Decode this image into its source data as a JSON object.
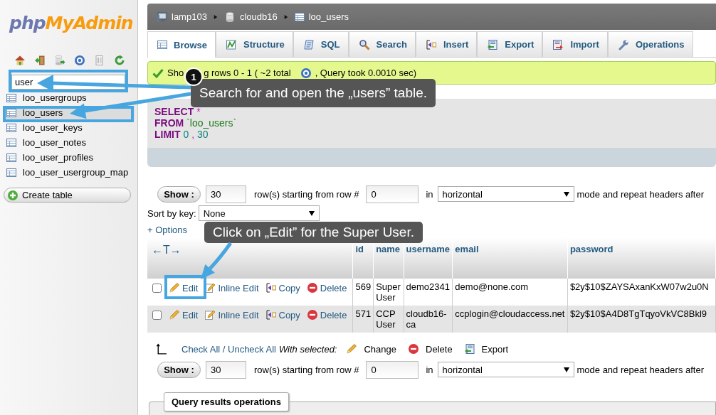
{
  "logo": {
    "part_1": "php",
    "part_2": "MyAdmin"
  },
  "sidebar": {
    "filter": {
      "value": "user"
    },
    "tables": [
      {
        "name": "loo_usergroups",
        "selected": false
      },
      {
        "name": "loo_users",
        "selected": true
      },
      {
        "name": "loo_user_keys",
        "selected": false
      },
      {
        "name": "loo_user_notes",
        "selected": false
      },
      {
        "name": "loo_user_profiles",
        "selected": false
      },
      {
        "name": "loo_user_usergroup_map",
        "selected": false
      }
    ],
    "create_button": "Create table"
  },
  "breadcrumb": [
    "lamp103",
    "cloudb16",
    "loo_users"
  ],
  "tabs": [
    {
      "label": "Browse",
      "selected": true
    },
    {
      "label": "Structure",
      "selected": false
    },
    {
      "label": "SQL",
      "selected": false
    },
    {
      "label": "Search",
      "selected": false
    },
    {
      "label": "Insert",
      "selected": false
    },
    {
      "label": "Export",
      "selected": false
    },
    {
      "label": "Import",
      "selected": false
    },
    {
      "label": "Operations",
      "selected": false
    }
  ],
  "message": {
    "text_1": "Sho",
    "text_2": "g rows 0 - 1 ( ~2 total",
    "tail": ", Query took 0.0010 sec)"
  },
  "sql": [
    [
      {
        "kind": "keyword",
        "text": "SELECT"
      },
      {
        "kind": "operator",
        "text": "*"
      }
    ],
    [
      {
        "kind": "keyword",
        "text": "FROM"
      },
      {
        "kind": "identifier",
        "text": "`loo_users`"
      }
    ],
    [
      {
        "kind": "keyword",
        "text": "LIMIT"
      },
      {
        "kind": "number",
        "text": "0"
      },
      {
        "kind": "operator",
        "text": ","
      },
      {
        "kind": "number",
        "text": "30"
      }
    ]
  ],
  "nav_top": {
    "show": "Show :",
    "rows": "30",
    "starting": "row(s) starting from row #",
    "start": "0",
    "in": "in",
    "mode": "horizontal",
    "after": "mode and repeat headers after"
  },
  "sort": {
    "label": "Sort by key:",
    "value": "None"
  },
  "options": "+ Options",
  "table": {
    "toggle": "←T→",
    "columns": [
      "id",
      "name",
      "username",
      "email",
      "password"
    ],
    "rows": [
      {
        "checked": false,
        "actions": [
          "Edit",
          "Inline Edit",
          "Copy",
          "Delete"
        ],
        "cells": [
          "569",
          "Super User",
          "demo2341",
          "demo@none.com",
          "$2y$10$ZAYSAxanKxW07w2u0N"
        ]
      },
      {
        "checked": false,
        "actions": [
          "Edit",
          "Inline Edit",
          "Copy",
          "Delete"
        ],
        "cells": [
          "571",
          "CCP User",
          "cloudb16-ca",
          "ccplogin@cloudaccess.net",
          "$2y$10$A4D8TgTqyoVkVC8Bkl9"
        ]
      }
    ]
  },
  "bulk": {
    "check_all": "Check All / Uncheck All",
    "with_selected": "With selected:",
    "actions": [
      "Change",
      "Delete",
      "Export"
    ]
  },
  "nav_bottom": {
    "show": "Show :",
    "rows": "30",
    "starting": "row(s) starting from row #",
    "start": "0",
    "in": "in",
    "mode": "horizontal",
    "after": "mode and repeat headers after"
  },
  "operations_title": "Query results operations",
  "tips": [
    {
      "badge": "1",
      "text": "Search for and open the „users” table."
    },
    {
      "text": "Click on „Edit” for the Super User."
    }
  ]
}
